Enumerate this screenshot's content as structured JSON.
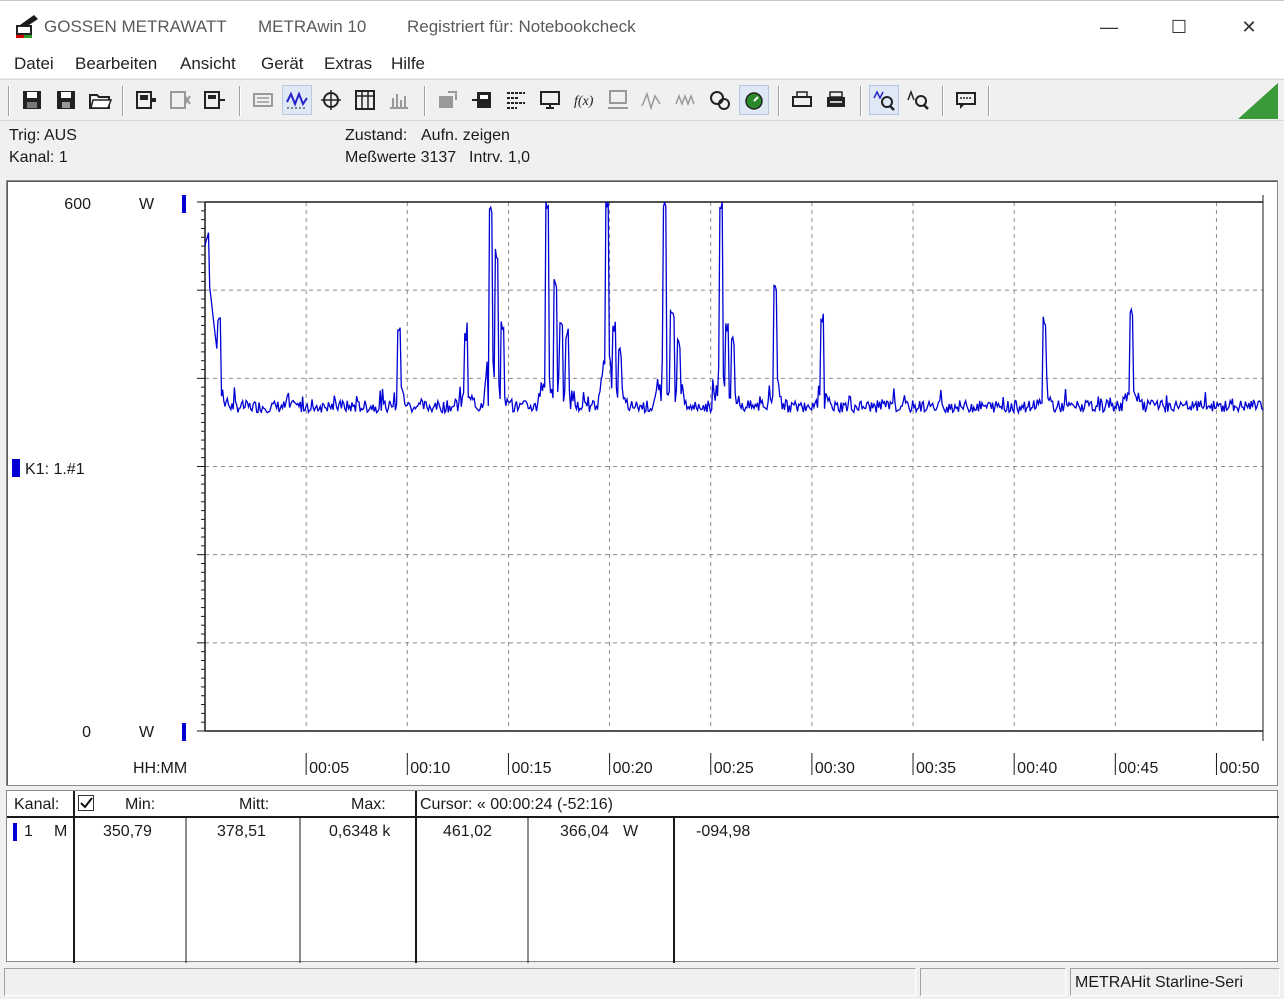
{
  "titlebar": {
    "company": "GOSSEN METRAWATT",
    "app": "METRAwin 10",
    "registered": "Registriert für: Notebookcheck",
    "minimize_glyph": "—",
    "maximize_glyph": "☐",
    "close_glyph": "✕"
  },
  "menu": [
    "Datei",
    "Bearbeiten",
    "Ansicht",
    "Gerät",
    "Extras",
    "Hilfe"
  ],
  "toolbar_icons": [
    "save-icon",
    "save-as-icon",
    "open-folder-icon",
    "device-connect-icon",
    "device-disconnect-icon",
    "device-read-icon",
    "print-preview-icon",
    "waveform-view-icon",
    "crosshair-view-icon",
    "table-view-icon",
    "bars-view-icon",
    "export-icon",
    "import-icon",
    "list-config-icon",
    "monitor-icon",
    "formula-icon",
    "computer-icon",
    "signal-icon",
    "waves-icon",
    "settings-icon",
    "trigger-icon",
    "print-icon",
    "print-all-icon",
    "zoom-in-icon",
    "zoom-out-icon",
    "comment-icon"
  ],
  "info": {
    "trig": "Trig: AUS",
    "kanal": "Kanal: 1",
    "zustand_label": "Zustand:",
    "zustand_value": "Aufn. zeigen",
    "messwerte": "Meßwerte 3137",
    "intrv": "Intrv. 1,0"
  },
  "chart_data": {
    "type": "line",
    "y_top_label": "600",
    "y_bottom_label": "0",
    "y_unit": "W",
    "ylim": [
      0,
      600
    ],
    "x_axis_label": "HH:MM",
    "x_ticks": [
      "00:05",
      "00:10",
      "00:15",
      "00:20",
      "00:25",
      "00:30",
      "00:35",
      "00:40",
      "00:45",
      "00:50"
    ],
    "xlim_minutes": [
      0,
      52.3
    ],
    "grid": true,
    "channel_label": "K1: 1.#1",
    "line_color": "#0000d4",
    "baseline_w": 368,
    "spikes": [
      {
        "t": 0.1,
        "w": 560
      },
      {
        "t": 0.7,
        "w": 470
      },
      {
        "t": 9.6,
        "w": 460
      },
      {
        "t": 12.9,
        "w": 445
      },
      {
        "t": 14.1,
        "w": 590
      },
      {
        "t": 14.4,
        "w": 540
      },
      {
        "t": 14.7,
        "w": 460
      },
      {
        "t": 16.9,
        "w": 600
      },
      {
        "t": 17.3,
        "w": 510
      },
      {
        "t": 17.6,
        "w": 460
      },
      {
        "t": 17.9,
        "w": 450
      },
      {
        "t": 19.9,
        "w": 600
      },
      {
        "t": 20.2,
        "w": 460
      },
      {
        "t": 20.5,
        "w": 430
      },
      {
        "t": 22.7,
        "w": 600
      },
      {
        "t": 23.1,
        "w": 470
      },
      {
        "t": 23.4,
        "w": 440
      },
      {
        "t": 25.5,
        "w": 600
      },
      {
        "t": 25.8,
        "w": 460
      },
      {
        "t": 26.1,
        "w": 440
      },
      {
        "t": 28.2,
        "w": 505
      },
      {
        "t": 30.5,
        "w": 460
      },
      {
        "t": 41.5,
        "w": 460
      },
      {
        "t": 45.8,
        "w": 475
      }
    ]
  },
  "datapanel": {
    "headers": {
      "kanal": "Kanal:",
      "min": "Min:",
      "mitt": "Mitt:",
      "max": "Max:",
      "cursor": "Cursor: « 00:00:24 (-52:16)"
    },
    "rows": [
      {
        "channel": "1",
        "mode": "M",
        "min": "350,79",
        "mitt": "378,51",
        "max": "0,6348 k",
        "cursor1": "461,02",
        "cursor2": "366,04",
        "unit": "W",
        "delta": "-094,98"
      }
    ]
  },
  "status": {
    "device": "METRAHit Starline-Seri"
  }
}
